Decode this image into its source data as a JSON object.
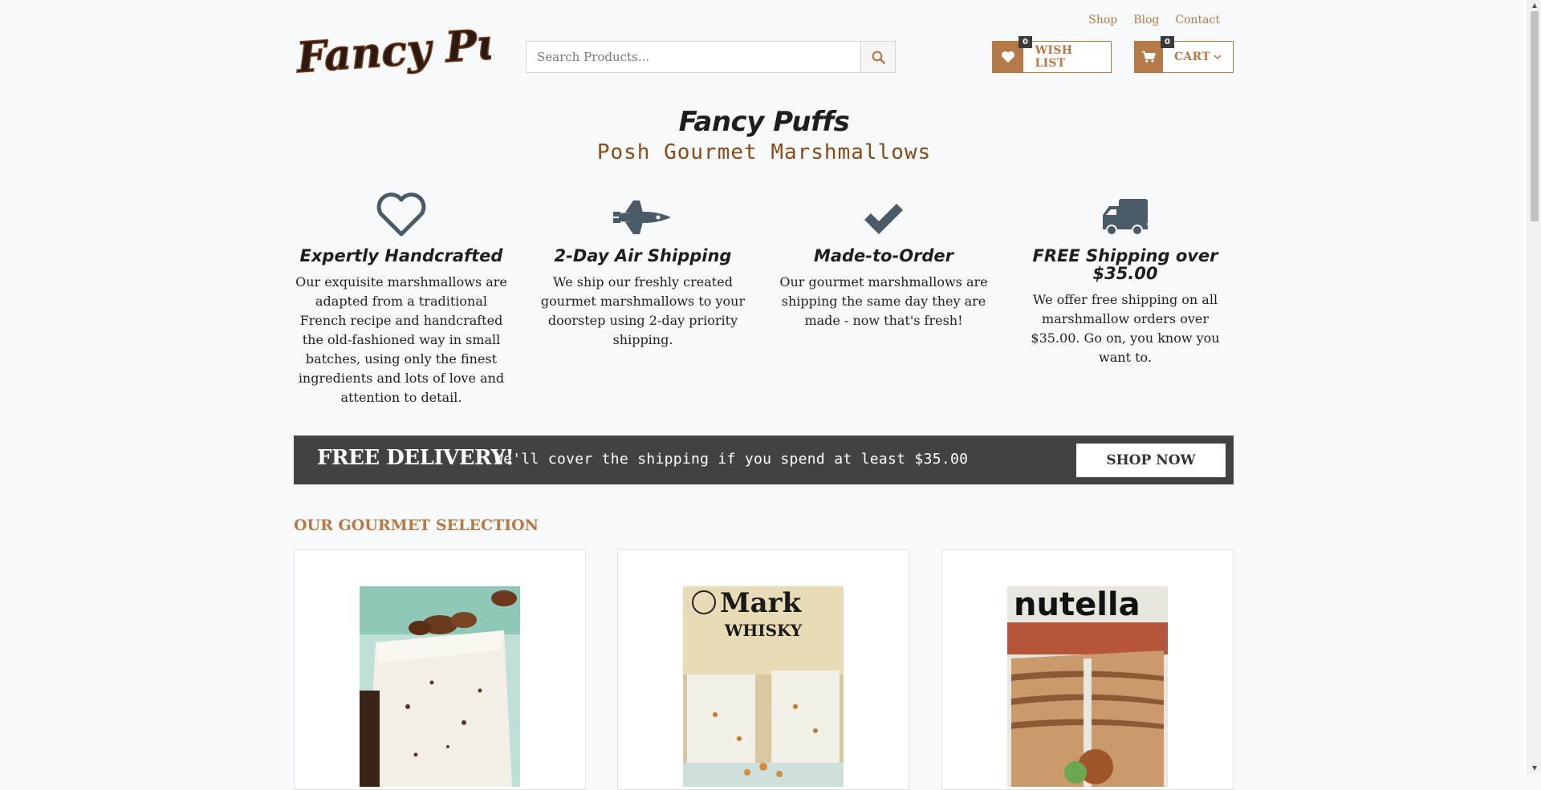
{
  "header": {
    "logo_text": "Fancy Puffs",
    "nav_links": [
      "Shop",
      "Blog",
      "Contact"
    ],
    "search_placeholder": "Search Products...",
    "wish_list": {
      "label": "WISH LIST",
      "count": "0"
    },
    "cart": {
      "label": "CART",
      "count": "0"
    }
  },
  "hero": {
    "title": "Fancy Puffs",
    "subtitle": "Posh Gourmet Marshmallows"
  },
  "features": [
    {
      "icon": "heart-icon",
      "title": "Expertly Handcrafted",
      "text": "Our exquisite marshmallows are adapted from a traditional French recipe and handcrafted the old-fashioned way in small batches, using only the finest ingredients and lots of love and attention to detail."
    },
    {
      "icon": "space-shuttle-icon",
      "title": "2-Day Air Shipping",
      "text": "We ship our freshly created gourmet marshmallows to your doorstep using 2-day priority shipping."
    },
    {
      "icon": "checkmark-icon",
      "title": "Made-to-Order",
      "text": "Our gourmet marshmallows are shipping the same day they are made - now that's fresh!"
    },
    {
      "icon": "truck-icon",
      "title": "FREE Shipping over $35.00",
      "text": "We offer free shipping on all marshmallow orders over $35.00. Go on, you know you want to."
    }
  ],
  "banner": {
    "title": "FREE DELIVERY!",
    "text": "We'll cover the shipping if you spend at least $35.00",
    "button": "SHOP NOW"
  },
  "selection": {
    "title": "OUR GOURMET SELECTION",
    "products": [
      {
        "image_text": ""
      },
      {
        "image_text": "Mark",
        "image_subtext": "WHISKY"
      },
      {
        "image_text": "nutella"
      }
    ]
  },
  "colors": {
    "accent": "#b67a48",
    "dark": "#424242",
    "icon": "#4a5a66",
    "subtitle": "#8a4a16"
  }
}
